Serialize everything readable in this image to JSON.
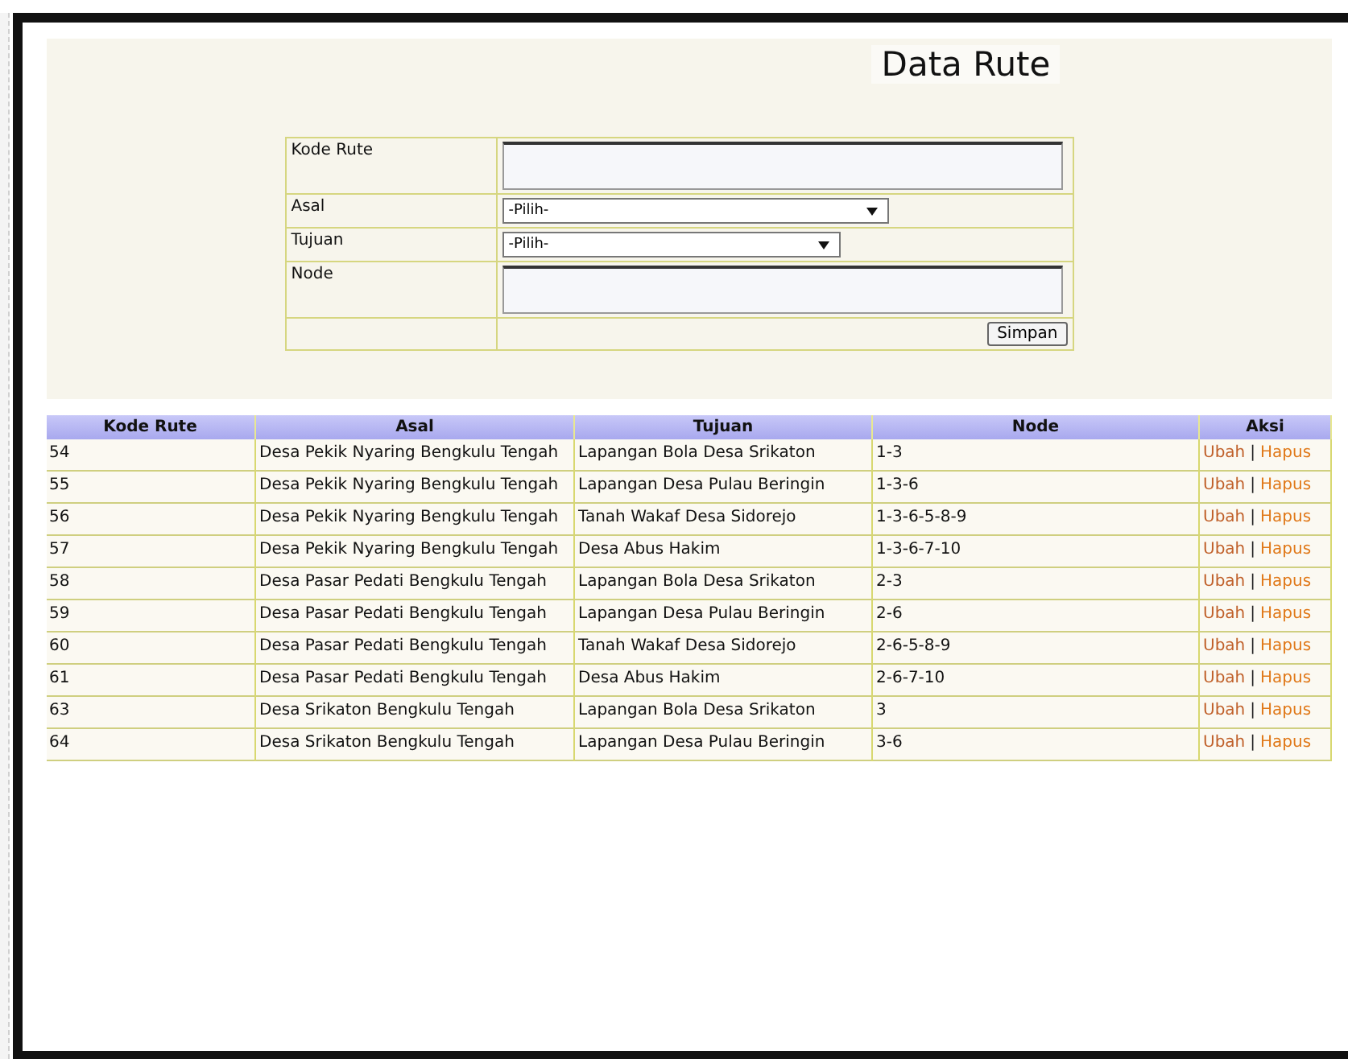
{
  "title": "Data Rute",
  "form": {
    "fields": [
      {
        "label": "Kode Rute",
        "kind": "textarea"
      },
      {
        "label": "Asal",
        "kind": "select",
        "value": "-Pilih-"
      },
      {
        "label": "Tujuan",
        "kind": "select",
        "value": "-Pilih-"
      },
      {
        "label": "Node",
        "kind": "textarea"
      }
    ],
    "submit": "Simpan"
  },
  "table": {
    "columns": [
      "Kode Rute",
      "Asal",
      "Tujuan",
      "Node",
      "Aksi"
    ],
    "rows": [
      {
        "kode": "54",
        "asal": "Desa Pekik Nyaring Bengkulu Tengah",
        "tujuan": "Lapangan Bola Desa Srikaton",
        "node": "1-3",
        "edit": "Ubah",
        "separator": "|",
        "delete": "Hapus"
      },
      {
        "kode": "55",
        "asal": "Desa Pekik Nyaring Bengkulu Tengah",
        "tujuan": "Lapangan Desa Pulau Beringin",
        "node": "1-3-6",
        "edit": "Ubah",
        "separator": "|",
        "delete": "Hapus"
      },
      {
        "kode": "56",
        "asal": "Desa Pekik Nyaring Bengkulu Tengah",
        "tujuan": "Tanah Wakaf Desa Sidorejo",
        "node": "1-3-6-5-8-9",
        "edit": "Ubah",
        "separator": "|",
        "delete": "Hapus"
      },
      {
        "kode": "57",
        "asal": "Desa Pekik Nyaring Bengkulu Tengah",
        "tujuan": "Desa Abus Hakim",
        "node": "1-3-6-7-10",
        "edit": "Ubah",
        "separator": "|",
        "delete": "Hapus"
      },
      {
        "kode": "58",
        "asal": "Desa Pasar Pedati Bengkulu Tengah",
        "tujuan": "Lapangan Bola Desa Srikaton",
        "node": "2-3",
        "edit": "Ubah",
        "separator": "|",
        "delete": "Hapus"
      },
      {
        "kode": "59",
        "asal": "Desa Pasar Pedati Bengkulu Tengah",
        "tujuan": "Lapangan Desa Pulau Beringin",
        "node": "2-6",
        "edit": "Ubah",
        "separator": "|",
        "delete": "Hapus"
      },
      {
        "kode": "60",
        "asal": "Desa Pasar Pedati Bengkulu Tengah",
        "tujuan": "Tanah Wakaf Desa Sidorejo",
        "node": "2-6-5-8-9",
        "edit": "Ubah",
        "separator": "|",
        "delete": "Hapus"
      },
      {
        "kode": "61",
        "asal": "Desa Pasar Pedati Bengkulu Tengah",
        "tujuan": "Desa Abus Hakim",
        "node": "2-6-7-10",
        "edit": "Ubah",
        "separator": "|",
        "delete": "Hapus"
      },
      {
        "kode": "63",
        "asal": "Desa Srikaton Bengkulu Tengah",
        "tujuan": "Lapangan Bola Desa Srikaton",
        "node": "3",
        "edit": "Ubah",
        "separator": "|",
        "delete": "Hapus"
      },
      {
        "kode": "64",
        "asal": "Desa Srikaton Bengkulu Tengah",
        "tujuan": "Lapangan Desa Pulau Beringin",
        "node": "3-6",
        "edit": "Ubah",
        "separator": "|",
        "delete": "Hapus"
      }
    ]
  }
}
